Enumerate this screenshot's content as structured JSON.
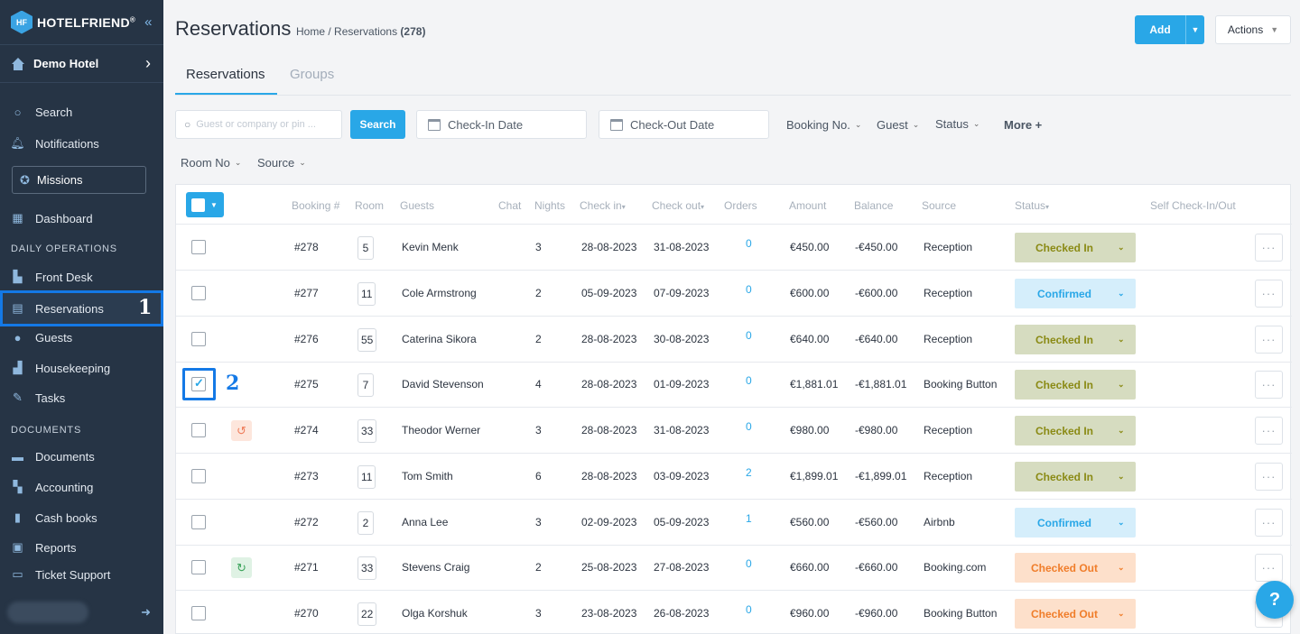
{
  "brand": {
    "name": "HOTELFRIEND",
    "trademark": "®",
    "logo_text": "HF"
  },
  "hotel": {
    "name": "Demo Hotel"
  },
  "sidebar": {
    "items": [
      {
        "label": "Search",
        "icon": "search-icon"
      },
      {
        "label": "Notifications",
        "icon": "bell-icon"
      },
      {
        "label": "Missions",
        "icon": "award-icon"
      },
      {
        "label": "Dashboard",
        "icon": "dashboard-icon"
      },
      {
        "label": "Front Desk",
        "icon": "front-desk-icon"
      },
      {
        "label": "Reservations",
        "icon": "document-icon"
      },
      {
        "label": "Guests",
        "icon": "user-icon"
      },
      {
        "label": "Housekeeping",
        "icon": "housekeeping-icon"
      },
      {
        "label": "Tasks",
        "icon": "wrench-icon"
      },
      {
        "label": "Documents",
        "icon": "folder-icon"
      },
      {
        "label": "Accounting",
        "icon": "accounting-icon"
      },
      {
        "label": "Cash books",
        "icon": "book-icon"
      },
      {
        "label": "Reports",
        "icon": "reports-icon"
      },
      {
        "label": "Ticket Support",
        "icon": "support-icon"
      }
    ],
    "sections": {
      "daily": "DAILY OPERATIONS",
      "documents": "DOCUMENTS"
    }
  },
  "annotations": {
    "one": "1",
    "two": "2"
  },
  "header": {
    "title": "Reservations",
    "breadcrumb_home": "Home",
    "breadcrumb_sep": "/",
    "breadcrumb_current": "Reservations",
    "count": "(278)",
    "add_label": "Add",
    "actions_label": "Actions"
  },
  "tabs": [
    {
      "label": "Reservations"
    },
    {
      "label": "Groups"
    }
  ],
  "filters": {
    "search_placeholder": "Guest or company or pin ...",
    "search_label": "Search",
    "checkin": "Check-In Date",
    "checkout": "Check-Out Date",
    "booking_no": "Booking No.",
    "guest": "Guest",
    "status": "Status",
    "more": "More +",
    "room_no": "Room No",
    "source": "Source"
  },
  "columns": {
    "booking": "Booking #",
    "room": "Room",
    "guests": "Guests",
    "chat": "Chat",
    "nights": "Nights",
    "checkin": "Check in",
    "checkout": "Check out",
    "orders": "Orders",
    "amount": "Amount",
    "balance": "Balance",
    "source": "Source",
    "status": "Status",
    "self_check": "Self Check-In/Out"
  },
  "colors": {
    "accent": "#29a7e7",
    "sidebar": "#263445",
    "highlight": "#1479e6"
  },
  "rows": [
    {
      "booking": "#278",
      "room": "5",
      "guest": "Kevin Menk",
      "nights": "3",
      "checkin": "28-08-2023",
      "checkout": "31-08-2023",
      "orders": "0",
      "amount": "€450.00",
      "balance": "-€450.00",
      "source": "Reception",
      "status": "Checked In",
      "checked": false,
      "icon": ""
    },
    {
      "booking": "#277",
      "room": "11",
      "guest": "Cole Armstrong",
      "nights": "2",
      "checkin": "05-09-2023",
      "checkout": "07-09-2023",
      "orders": "0",
      "amount": "€600.00",
      "balance": "-€600.00",
      "source": "Reception",
      "status": "Confirmed",
      "checked": false,
      "icon": ""
    },
    {
      "booking": "#276",
      "room": "55",
      "guest": "Caterina Sikora",
      "nights": "2",
      "checkin": "28-08-2023",
      "checkout": "30-08-2023",
      "orders": "0",
      "amount": "€640.00",
      "balance": "-€640.00",
      "source": "Reception",
      "status": "Checked In",
      "checked": false,
      "icon": ""
    },
    {
      "booking": "#275",
      "room": "7",
      "guest": "David Stevenson",
      "nights": "4",
      "checkin": "28-08-2023",
      "checkout": "01-09-2023",
      "orders": "0",
      "amount": "€1,881.01",
      "balance": "-€1,881.01",
      "source": "Booking Button",
      "status": "Checked In",
      "checked": true,
      "icon": ""
    },
    {
      "booking": "#274",
      "room": "33",
      "guest": "Theodor Werner",
      "nights": "3",
      "checkin": "28-08-2023",
      "checkout": "31-08-2023",
      "orders": "0",
      "amount": "€980.00",
      "balance": "-€980.00",
      "source": "Reception",
      "status": "Checked In",
      "checked": false,
      "icon": "history-icon"
    },
    {
      "booking": "#273",
      "room": "11",
      "guest": "Tom Smith",
      "nights": "6",
      "checkin": "28-08-2023",
      "checkout": "03-09-2023",
      "orders": "2",
      "amount": "€1,899.01",
      "balance": "-€1,899.01",
      "source": "Reception",
      "status": "Checked In",
      "checked": false,
      "icon": ""
    },
    {
      "booking": "#272",
      "room": "2",
      "guest": "Anna Lee",
      "nights": "3",
      "checkin": "02-09-2023",
      "checkout": "05-09-2023",
      "orders": "1",
      "amount": "€560.00",
      "balance": "-€560.00",
      "source": "Airbnb",
      "status": "Confirmed",
      "checked": false,
      "icon": ""
    },
    {
      "booking": "#271",
      "room": "33",
      "guest": "Stevens Craig",
      "nights": "2",
      "checkin": "25-08-2023",
      "checkout": "27-08-2023",
      "orders": "0",
      "amount": "€660.00",
      "balance": "-€660.00",
      "source": "Booking.com",
      "status": "Checked Out",
      "checked": false,
      "icon": "refresh-icon"
    },
    {
      "booking": "#270",
      "room": "22",
      "guest": "Olga Korshuk",
      "nights": "3",
      "checkin": "23-08-2023",
      "checkout": "26-08-2023",
      "orders": "0",
      "amount": "€960.00",
      "balance": "-€960.00",
      "source": "Booking Button",
      "status": "Checked Out",
      "checked": false,
      "icon": ""
    }
  ],
  "help_label": "?"
}
